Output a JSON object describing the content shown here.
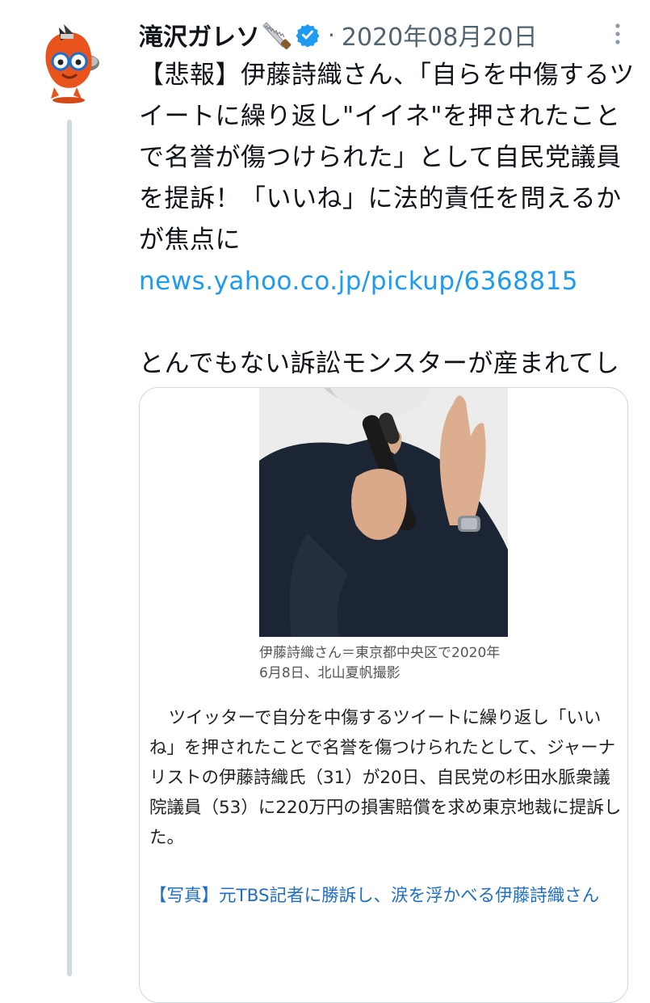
{
  "tweet": {
    "display_name": "滝沢ガレソ",
    "name_emoji": "carpentry-saw-emoji",
    "verified_icon": "verified-badge-icon",
    "timestamp": "2020年08月20日",
    "dot": "·",
    "more_icon": "more-vertical-icon",
    "avatar_icon": "orange-mascot-avatar",
    "text_part1": "【悲報】伊藤詩織さん、「自らを中傷するツイートに繰り返し\"イイネ\"を押されたことで名誉が傷つけられた」として自民党議員を提訴！「いいね」に法的責任を問えるかが焦点に ",
    "link_text": "news.yahoo.co.jp/pickup/6368815",
    "text_part2": "とんでもない訴訟モンスターが産まれてしまってませんか？"
  },
  "card": {
    "photo_icon": "news-photo-woman-with-microphone",
    "caption": "伊藤詩織さん＝東京都中央区で2020年6月8日、北山夏帆撮影",
    "body": "ツイッターで自分を中傷するツイートに繰り返し「いいね」を押されたことで名誉を傷つけられたとして、ジャーナリストの伊藤詩織氏（31）が20日、自民党の杉田水脈衆議院議員（53）に220万円の損害賠償を求め東京地裁に提訴した。",
    "related_link": "【写真】元TBS記者に勝訴し、涙を浮かべる伊藤詩織さん"
  },
  "colors": {
    "link": "#1d9bf0",
    "verified": "#1d9bf0",
    "avatar": "#e8541c",
    "related_link": "#1f6fc4"
  }
}
